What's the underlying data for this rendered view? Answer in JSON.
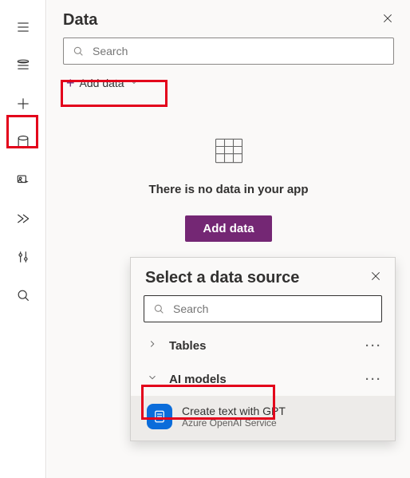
{
  "panel": {
    "title": "Data",
    "searchPlaceholder": "Search",
    "addDataLabel": "Add data",
    "emptyText": "There is no data in your app",
    "addDataButton": "Add data"
  },
  "flyout": {
    "title": "Select a data source",
    "searchPlaceholder": "Search",
    "groups": {
      "tables": "Tables",
      "aiModels": "AI models"
    },
    "item": {
      "title": "Create text with GPT",
      "subtitle": "Azure OpenAI Service"
    }
  },
  "colors": {
    "primary": "#742774",
    "highlight": "#e3001b"
  }
}
